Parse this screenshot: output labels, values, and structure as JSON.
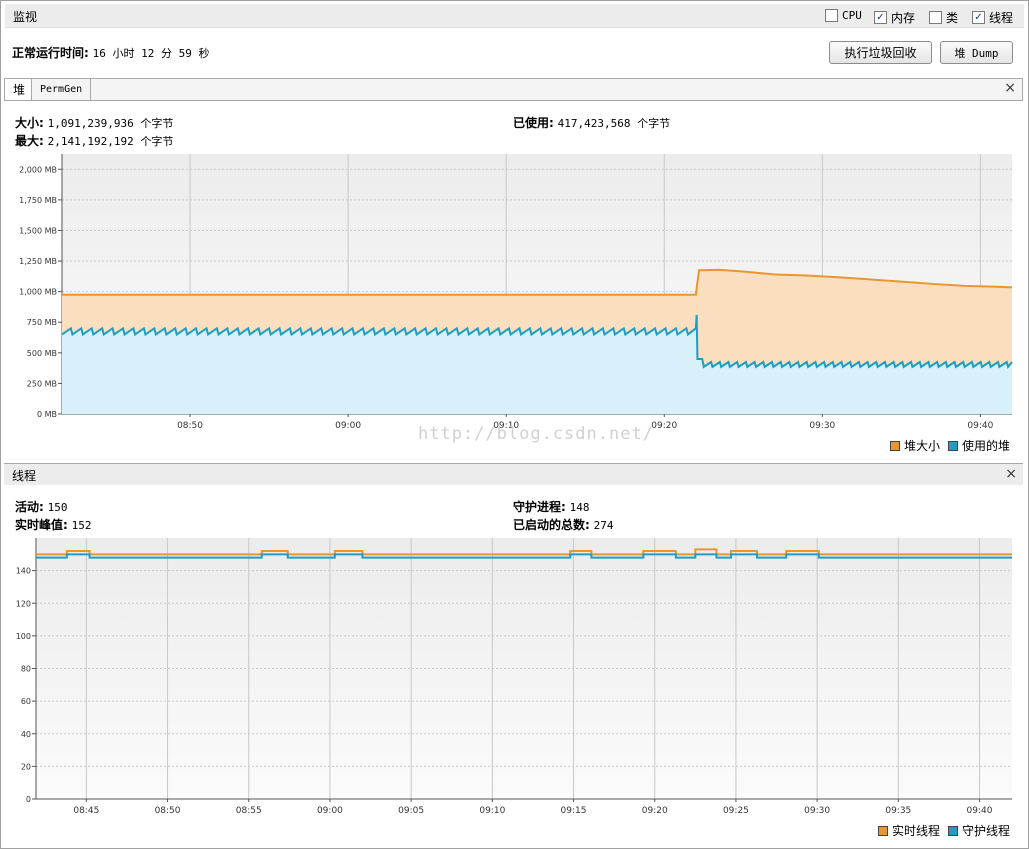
{
  "monitor": {
    "title": "监视",
    "checkboxes": [
      {
        "label": "CPU",
        "checked": false
      },
      {
        "label": "内存",
        "checked": true
      },
      {
        "label": "类",
        "checked": false
      },
      {
        "label": "线程",
        "checked": true
      }
    ],
    "uptime_label": "正常运行时间:",
    "uptime_value": "16 小时 12 分 59 秒",
    "gc_button": "执行垃圾回收",
    "dump_button": "堆 Dump"
  },
  "heap_panel": {
    "tabs": [
      "堆",
      "PermGen"
    ],
    "close_icon": "×",
    "size_label": "大小:",
    "size_value": "1,091,239,936 个字节",
    "max_label": "最大:",
    "max_value": "2,141,192,192 个字节",
    "used_label": "已使用:",
    "used_value": "417,423,568 个字节",
    "legend": [
      "堆大小",
      "使用的堆"
    ],
    "watermark": "http://blog.csdn.net/"
  },
  "thread_panel": {
    "title": "线程",
    "close_icon": "×",
    "live_label": "活动:",
    "live_value": "150",
    "daemon_label": "守护进程:",
    "daemon_value": "148",
    "peak_label": "实时峰值:",
    "peak_value": "152",
    "started_label": "已启动的总数:",
    "started_value": "274",
    "legend": [
      "实时线程",
      "守护线程"
    ]
  },
  "colors": {
    "heap_size": "#e8962f",
    "heap_size_fill": "#f9dfc0",
    "heap_used": "#1e9ec3",
    "heap_used_fill": "#d7f0fa",
    "plot_bg": "#f0f0f0",
    "grid": "#c8c8c8"
  },
  "chart_data": [
    {
      "type": "area",
      "y_tick_labels": [
        "0 MB",
        "250 MB",
        "500 MB",
        "750 MB",
        "1,000 MB",
        "1,250 MB",
        "1,500 MB",
        "1,750 MB",
        "2,000 MB"
      ],
      "y_ticks": [
        0,
        250,
        500,
        750,
        1000,
        1250,
        1500,
        1750,
        2000
      ],
      "ylim": [
        0,
        2125
      ],
      "x_tick_labels": [
        "08:50",
        "09:00",
        "09:10",
        "09:20",
        "09:30",
        "09:40"
      ],
      "x_ticks_min": [
        530,
        540,
        550,
        560,
        570,
        580
      ],
      "xlim_min": [
        521.9,
        582.0
      ],
      "grid": true,
      "legend_position": "bottom-right",
      "series": [
        {
          "name": "堆大小",
          "points": [
            [
              521.9,
              975
            ],
            [
              562.0,
              975
            ],
            [
              562.2,
              1175
            ],
            [
              563.5,
              1178
            ],
            [
              565,
              1165
            ],
            [
              567,
              1140
            ],
            [
              569,
              1132
            ],
            [
              571,
              1118
            ],
            [
              573,
              1100
            ],
            [
              575,
              1082
            ],
            [
              577,
              1063
            ],
            [
              579,
              1047
            ],
            [
              581,
              1040
            ],
            [
              582.0,
              1035
            ]
          ]
        },
        {
          "name": "使用的堆",
          "sawtooth": {
            "start": 521.9,
            "end": 562.0,
            "period": 0.66,
            "low": 650,
            "high": 700
          },
          "points": [
            [
              562.0,
              700
            ],
            [
              562.05,
              810
            ],
            [
              562.1,
              450
            ],
            [
              562.4,
              450
            ],
            [
              562.5,
              390
            ]
          ],
          "sawtooth2": {
            "start": 562.5,
            "end": 582.0,
            "period": 0.55,
            "low": 385,
            "high": 425
          }
        }
      ]
    },
    {
      "type": "line",
      "y_tick_labels": [
        "0",
        "20",
        "40",
        "60",
        "80",
        "100",
        "120",
        "140"
      ],
      "y_ticks": [
        0,
        20,
        40,
        60,
        80,
        100,
        120,
        140
      ],
      "ylim": [
        0,
        160
      ],
      "x_tick_labels": [
        "08:45",
        "08:50",
        "08:55",
        "09:00",
        "09:05",
        "09:10",
        "09:15",
        "09:20",
        "09:25",
        "09:30",
        "09:35",
        "09:40"
      ],
      "x_ticks_min": [
        525,
        530,
        535,
        540,
        545,
        550,
        555,
        560,
        565,
        570,
        575,
        580
      ],
      "xlim_min": [
        521.9,
        582.0
      ],
      "grid": true,
      "legend_position": "bottom-right",
      "series": [
        {
          "name": "实时线程",
          "steps": [
            [
              521.9,
              150
            ],
            [
              523.8,
              152
            ],
            [
              525.2,
              150
            ],
            [
              535.8,
              152
            ],
            [
              537.4,
              150
            ],
            [
              540.3,
              152
            ],
            [
              542.0,
              150
            ],
            [
              554.8,
              152
            ],
            [
              556.1,
              150
            ],
            [
              559.3,
              152
            ],
            [
              561.3,
              150
            ],
            [
              562.5,
              153
            ],
            [
              563.8,
              150
            ],
            [
              564.7,
              152
            ],
            [
              566.3,
              150
            ],
            [
              568.1,
              152
            ],
            [
              570.1,
              150
            ],
            [
              582.0,
              150
            ]
          ]
        },
        {
          "name": "守护线程",
          "steps": [
            [
              521.9,
              148
            ],
            [
              523.8,
              150
            ],
            [
              525.2,
              148
            ],
            [
              535.8,
              150
            ],
            [
              537.4,
              148
            ],
            [
              540.3,
              150
            ],
            [
              542.0,
              148
            ],
            [
              554.8,
              150
            ],
            [
              556.1,
              148
            ],
            [
              559.3,
              150
            ],
            [
              561.3,
              148
            ],
            [
              562.5,
              150
            ],
            [
              563.8,
              148
            ],
            [
              564.7,
              150
            ],
            [
              566.3,
              148
            ],
            [
              568.1,
              150
            ],
            [
              570.1,
              148
            ],
            [
              582.0,
              148
            ]
          ]
        }
      ]
    }
  ]
}
